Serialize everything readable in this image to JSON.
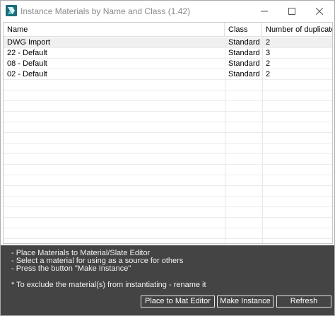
{
  "window": {
    "title": "Instance Materials by Name and Class (1.42)"
  },
  "listview": {
    "columns": [
      "Name",
      "Class",
      "Number of duplicates"
    ],
    "rows": [
      {
        "name": "DWG Import",
        "class": "Standard",
        "duplicates": "2"
      },
      {
        "name": "22 - Default",
        "class": "Standard",
        "duplicates": "3"
      },
      {
        "name": "08 - Default",
        "class": "Standard",
        "duplicates": "2"
      },
      {
        "name": "02 - Default",
        "class": "Standard",
        "duplicates": "2"
      }
    ]
  },
  "hints": {
    "line1": "- Place Materials to Material/Slate Editor",
    "line2": "- Select a material for using as a source for others",
    "line3": "- Press the button \"Make Instance\"",
    "note": "* To exclude the material(s) from instantiating - rename it"
  },
  "buttons": {
    "place": "Place to Mat Editor",
    "make": "Make Instance",
    "refresh": "Refresh"
  },
  "icons": {
    "app": "3ds-max-app-icon",
    "minimize": "minimize-icon",
    "maximize": "maximize-icon",
    "close": "close-icon"
  },
  "colors": {
    "panel": "#444444",
    "app_icon": "#1b6f7a"
  }
}
